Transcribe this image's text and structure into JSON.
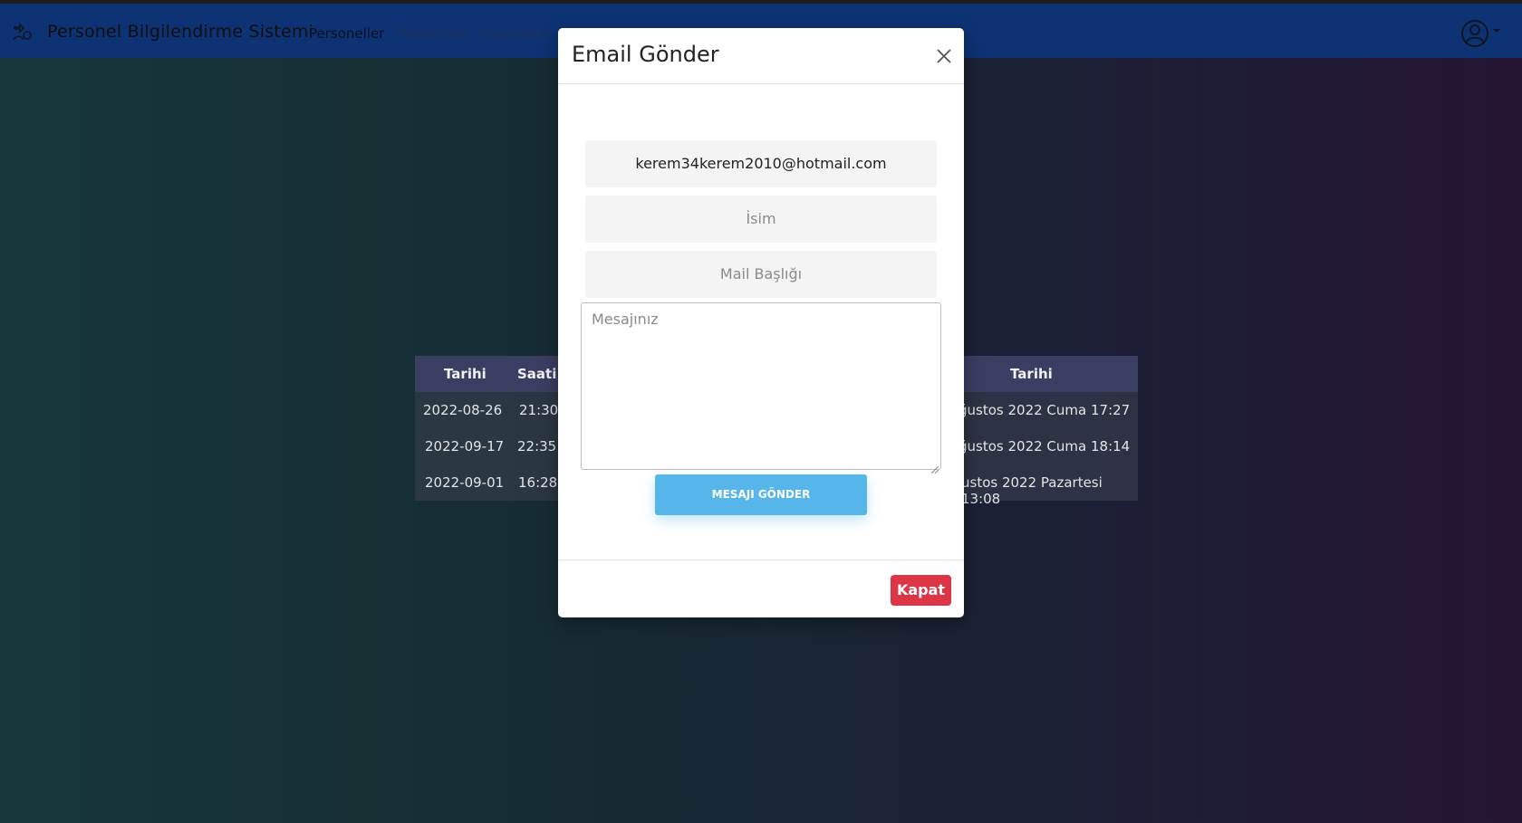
{
  "app": {
    "title": "Personel Bilgilendirme Sistemi"
  },
  "nav": {
    "items": [
      {
        "label": "Personeller"
      },
      {
        "label": "Toplantılar"
      },
      {
        "label": "Duyurular"
      }
    ]
  },
  "table": {
    "headers": [
      "Tarihi",
      "Saati",
      "Tarihi"
    ],
    "rows": [
      {
        "date": "2022-08-26",
        "time": "21:30",
        "created": "ğustos 2022 Cuma 17:27"
      },
      {
        "date": "2022-09-17",
        "time": "22:35",
        "created": "ğustos 2022 Cuma 18:14"
      },
      {
        "date": "2022-09-01",
        "time": "16:28",
        "created": "ustos 2022 Pazartesi 13:08"
      }
    ]
  },
  "modal": {
    "title": "Email Gönder",
    "email_value": "kerem34kerem2010@hotmail.com",
    "name_placeholder": "İsim",
    "subject_placeholder": "Mail Başlığı",
    "message_placeholder": "Mesajınız",
    "send_label": "MESAJI GÖNDER",
    "close_label": "Kapat"
  },
  "colors": {
    "navbar": "#1b67e8",
    "send_button": "#57b6e9",
    "close_button": "#dc3545",
    "table_header": "#3b3e63"
  }
}
